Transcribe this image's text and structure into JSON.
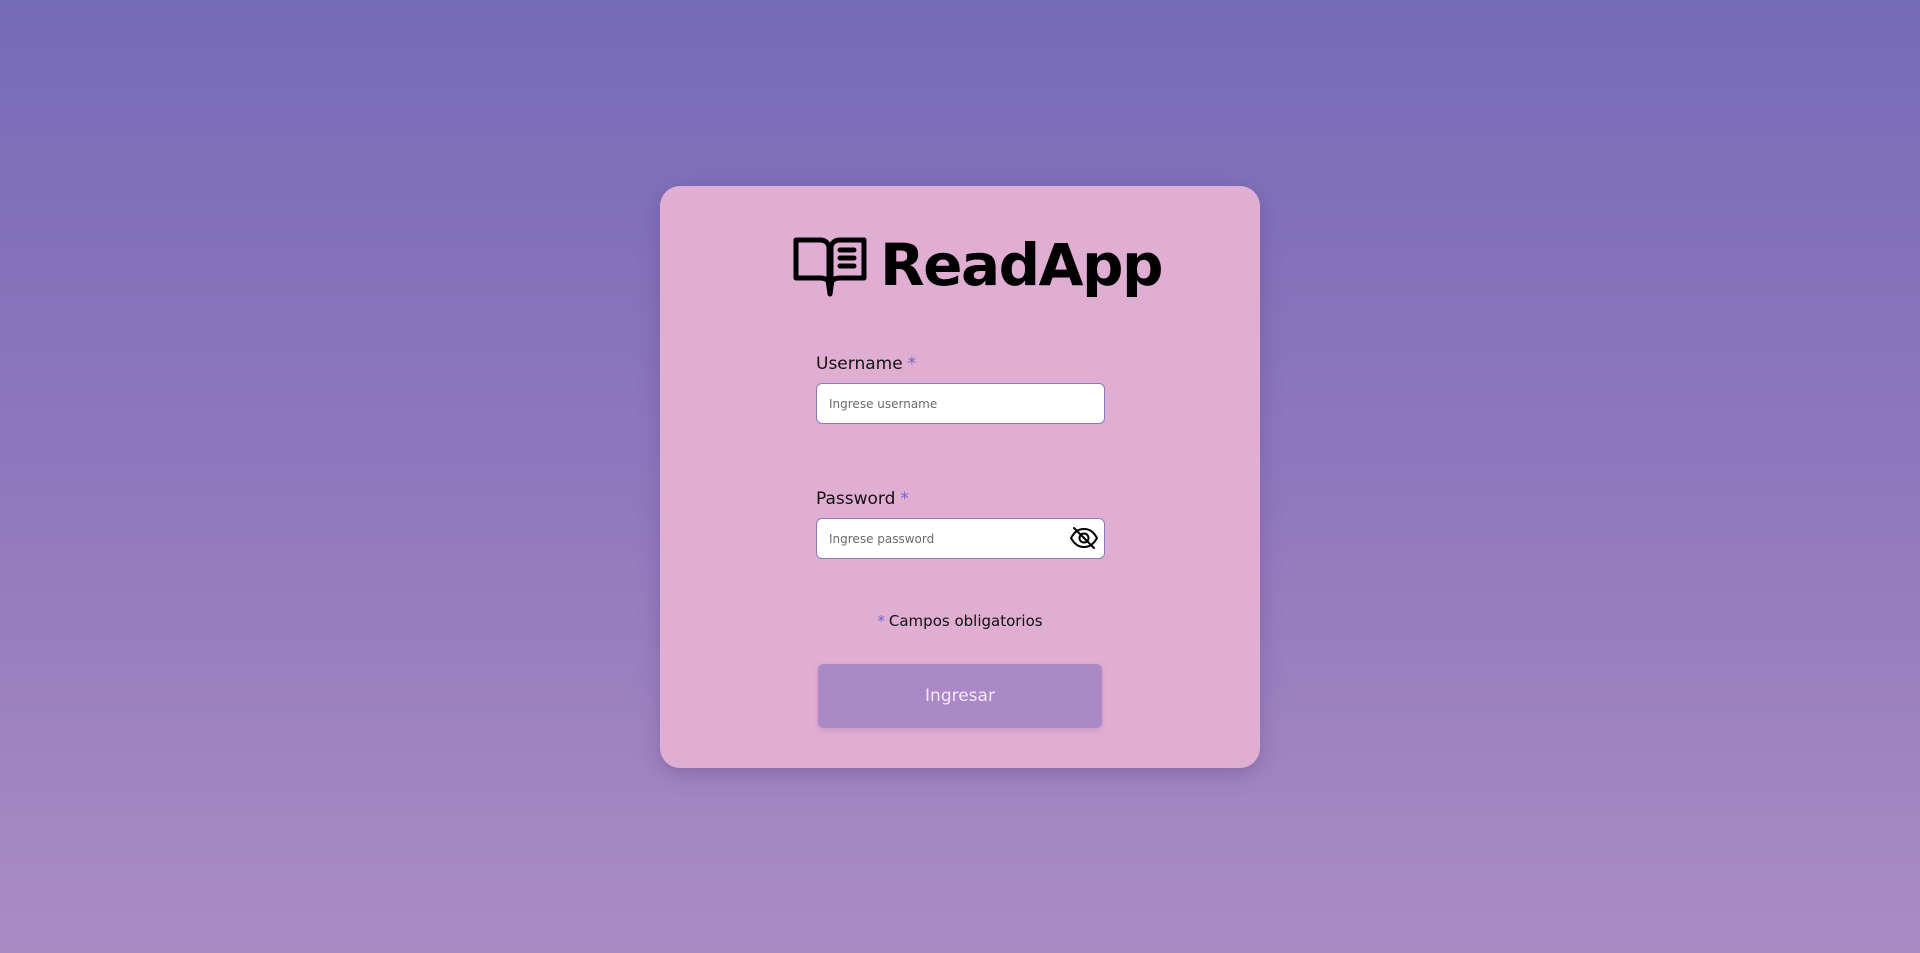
{
  "brand": {
    "title": "ReadApp",
    "icon": "open-book-icon"
  },
  "form": {
    "username": {
      "label": "Username",
      "required_mark": "*",
      "placeholder": "Ingrese username",
      "value": ""
    },
    "password": {
      "label": "Password",
      "required_mark": "*",
      "placeholder": "Ingrese password",
      "value": "",
      "toggle_icon": "eye-slash-icon"
    },
    "required_note": {
      "mark": "*",
      "text": "Campos obligatorios"
    },
    "submit_label": "Ingresar"
  },
  "colors": {
    "background_top": "#766bb7",
    "background_bottom": "#ab8bc4",
    "card": "#e0aed2",
    "required_mark": "#6f66c6",
    "input_border": "#8a7ab8",
    "button": "#ab88c6",
    "button_text": "#f3e9f6"
  }
}
